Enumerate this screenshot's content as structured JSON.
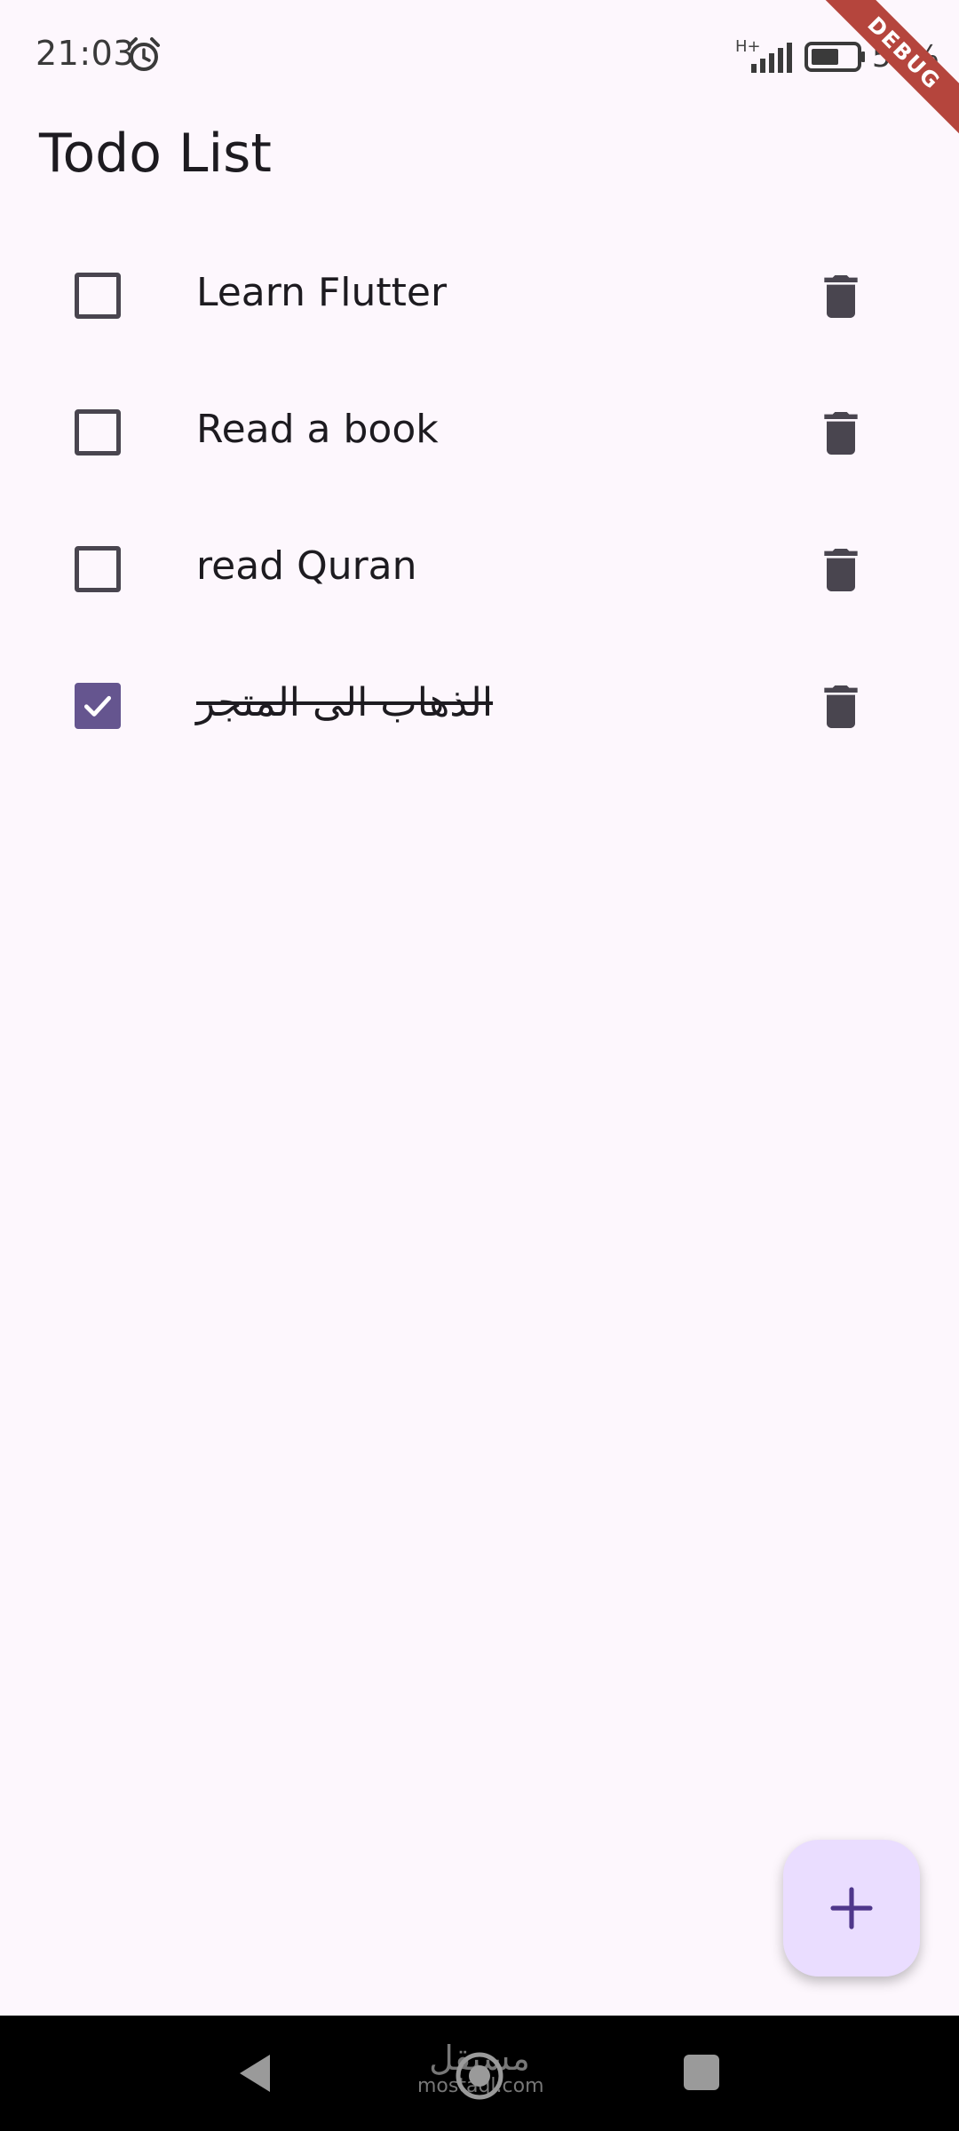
{
  "status_bar": {
    "time": "21:03",
    "network": "H+",
    "battery": "56%",
    "alarm_icon": "alarm-icon",
    "signal_icon": "signal-icon",
    "battery_icon": "battery-icon"
  },
  "debug_banner": "DEBUG",
  "app_bar": {
    "title": "Todo List"
  },
  "todos": [
    {
      "label": "Learn Flutter",
      "checked": false
    },
    {
      "label": "Read a book",
      "checked": false
    },
    {
      "label": "read Quran",
      "checked": false
    },
    {
      "label": "الذهاب الى المتجر",
      "checked": true
    }
  ],
  "fab": {
    "icon": "add-icon"
  },
  "nav_bar": {
    "back_icon": "back-icon",
    "home_icon": "home-icon",
    "recents_icon": "recents-icon"
  },
  "watermark": {
    "arabic": "مستقل",
    "latin": "mostaql.com"
  },
  "colors": {
    "background": "#FDF7FD",
    "accent": "#65558F",
    "fab": "#EADDFF",
    "icon": "#49454F",
    "debug": "#B5453D"
  }
}
